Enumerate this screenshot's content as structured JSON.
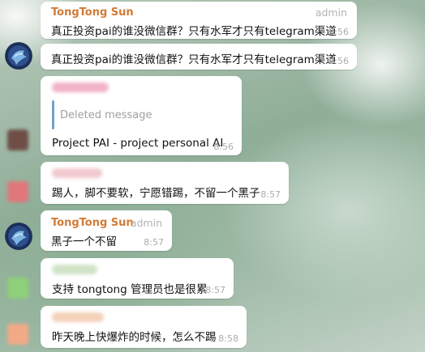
{
  "messages": [
    {
      "name": "TongTong Sun",
      "role": "admin",
      "text": "真正投资pai的谁没微信群？只有水军才只有telegram渠道",
      "time": "8:56"
    },
    {
      "text": "真正投资pai的谁没微信群？只有水军才只有telegram渠道",
      "time": "8:56"
    },
    {
      "reply": "Deleted message",
      "text": "Project PAI - project personal AI",
      "time": "8:56"
    },
    {
      "text": "踢人，脚不要软，宁愿错踢，不留一个黑子",
      "time": "8:57"
    },
    {
      "name": "TongTong Sun",
      "role": "admin",
      "text": "黑子一个不留",
      "time": "8:57"
    },
    {
      "text": "支持 tongtong 管理员也是很累",
      "time": "8:57"
    },
    {
      "text": "昨天晚上快爆炸的时候，怎么不踢",
      "time": "8:58"
    }
  ],
  "colors": {
    "sender_name": "#d17b35",
    "reply_bar": "#74a2c4",
    "timestamp": "#a8b0a8"
  }
}
